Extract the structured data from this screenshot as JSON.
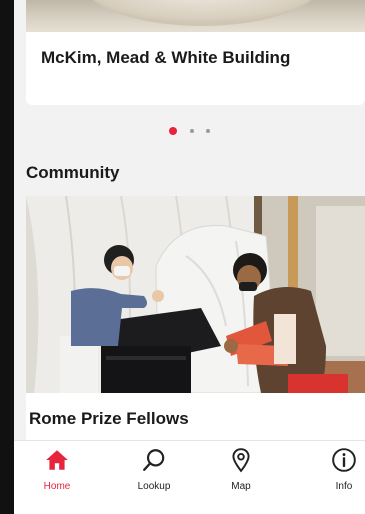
{
  "carousel": {
    "title": "McKim, Mead & White Building",
    "dots_count": 3,
    "active_dot": 0
  },
  "community": {
    "section_title": "Community",
    "card_title": "Rome Prize Fellows"
  },
  "tabbar": {
    "items": [
      {
        "label": "Home",
        "icon": "home-icon",
        "active": true
      },
      {
        "label": "Lookup",
        "icon": "search-icon",
        "active": false
      },
      {
        "label": "Map",
        "icon": "map-pin-icon",
        "active": false
      },
      {
        "label": "Info",
        "icon": "info-icon",
        "active": false
      }
    ]
  },
  "colors": {
    "accent": "#e8233d",
    "background": "#f2f2f2",
    "card": "#ffffff",
    "text": "#1a1a1a"
  }
}
